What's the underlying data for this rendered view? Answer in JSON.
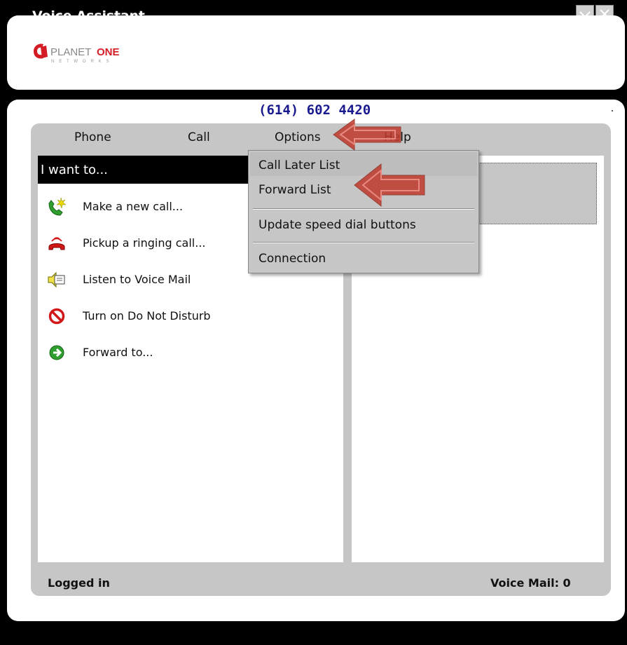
{
  "window": {
    "title": "Voice Assistant",
    "buttons": [
      "minimize-icon",
      "close-icon"
    ]
  },
  "brand": {
    "logo_text_1": "PLANET",
    "logo_text_2": "ONE",
    "logo_sub": "N E T W O R K S",
    "colors": {
      "logo_red": "#d41c24",
      "logo_gray": "#888888"
    }
  },
  "header": {
    "phone_number": "(614) 602 4420"
  },
  "menubar": {
    "items": [
      {
        "label": "Phone"
      },
      {
        "label": "Call"
      },
      {
        "label": "Options"
      },
      {
        "label": "Help"
      }
    ]
  },
  "left_panel": {
    "heading": "I want to...",
    "tasks": [
      {
        "label": "Make a new call...",
        "icon": "phone-new-call-icon"
      },
      {
        "label": "Pickup a ringing call...",
        "icon": "phone-ringing-icon"
      },
      {
        "label": "Listen to Voice Mail",
        "icon": "voicemail-speaker-icon"
      },
      {
        "label": "Turn on Do Not Disturb",
        "icon": "do-not-disturb-icon"
      },
      {
        "label": "Forward to...",
        "icon": "forward-arrow-icon"
      }
    ]
  },
  "options_menu": {
    "items": [
      {
        "label": "Call Later List"
      },
      {
        "label": "Forward List"
      },
      {
        "label": "Update speed dial buttons"
      },
      {
        "label": "Connection"
      }
    ]
  },
  "status": {
    "left": "Logged in",
    "right": "Voice Mail: 0"
  },
  "annotations": {
    "arrow_color": "#c0392b"
  }
}
